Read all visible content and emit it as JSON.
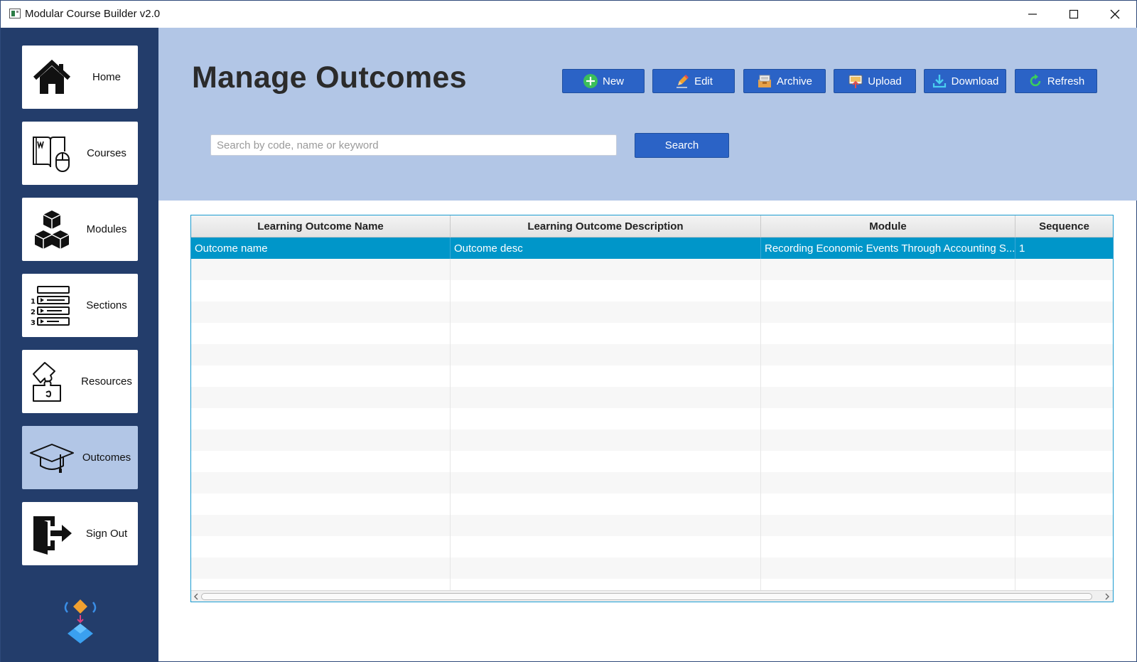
{
  "window": {
    "title": "Modular Course Builder v2.0"
  },
  "sidebar": {
    "items": [
      {
        "label": "Home",
        "icon": "home-icon",
        "active": false
      },
      {
        "label": "Courses",
        "icon": "book-mouse-icon",
        "active": false
      },
      {
        "label": "Modules",
        "icon": "cubes-icon",
        "active": false
      },
      {
        "label": "Sections",
        "icon": "numbered-list-icon",
        "active": false
      },
      {
        "label": "Resources",
        "icon": "puzzle-icon",
        "active": false
      },
      {
        "label": "Outcomes",
        "icon": "graduation-cap-icon",
        "active": true
      },
      {
        "label": "Sign Out",
        "icon": "exit-door-icon",
        "active": false
      }
    ]
  },
  "header": {
    "title": "Manage Outcomes",
    "buttons": [
      {
        "label": "New",
        "icon": "plus-circle-icon"
      },
      {
        "label": "Edit",
        "icon": "pencil-icon"
      },
      {
        "label": "Archive",
        "icon": "archive-box-icon"
      },
      {
        "label": "Upload",
        "icon": "upload-icon"
      },
      {
        "label": "Download",
        "icon": "download-icon"
      },
      {
        "label": "Refresh",
        "icon": "refresh-icon"
      }
    ],
    "search": {
      "placeholder": "Search by code, name or keyword",
      "value": "",
      "button_label": "Search"
    }
  },
  "table": {
    "columns": [
      "Learning Outcome Name",
      "Learning Outcome Description",
      "Module",
      "Sequence"
    ],
    "rows": [
      {
        "name": "Outcome name",
        "description": "Outcome desc",
        "module": "Recording Economic Events Through Accounting S...",
        "sequence": "1",
        "selected": true
      }
    ]
  },
  "colors": {
    "sidebar_bg": "#233d6b",
    "header_bg": "#b2c6e6",
    "button_bg": "#2b63c6",
    "selected_row": "#0096c9",
    "active_nav": "#b2c6e6"
  }
}
